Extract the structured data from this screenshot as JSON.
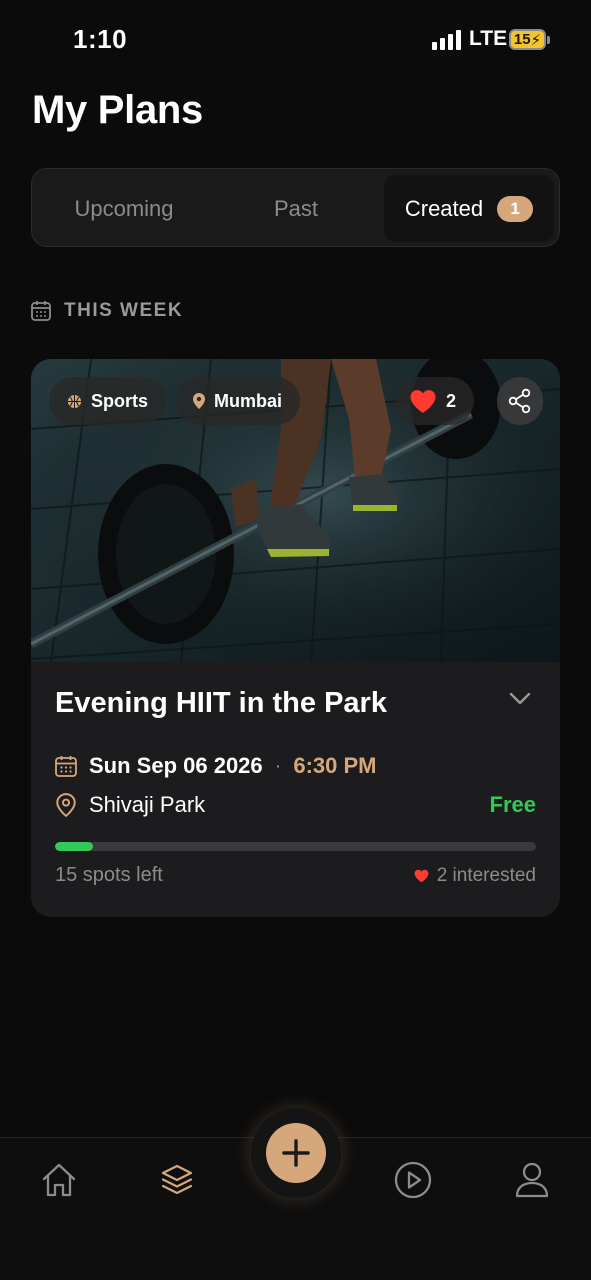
{
  "status_bar": {
    "time": "1:10",
    "network": "LTE",
    "battery": "15"
  },
  "page": {
    "title": "My Plans"
  },
  "tabs": [
    {
      "label": "Upcoming",
      "active": false
    },
    {
      "label": "Past",
      "active": false
    },
    {
      "label": "Created",
      "active": true,
      "badge": "1"
    }
  ],
  "section": {
    "title": "THIS WEEK",
    "icon": "calendar-icon"
  },
  "plan_card": {
    "category": "Sports",
    "location_tag": "Mumbai",
    "likes": "2",
    "title": "Evening HIIT in the Park",
    "date": "Sun Sep 06 2026",
    "separator": "·",
    "time": "6:30 PM",
    "venue": "Shivaji Park",
    "price": "Free",
    "spots_left": "15 spots left",
    "interested": "2 interested",
    "progress_fraction": 0.08
  },
  "bottom_nav": {
    "items": [
      "home-icon",
      "layers-icon",
      "add-icon",
      "play-icon",
      "profile-icon"
    ],
    "active": "layers-icon"
  },
  "colors": {
    "accent": "#d6a77a",
    "success": "#34c759",
    "heart": "#ff3b30",
    "background": "#0b0b0b",
    "card": "#1c1c1e"
  }
}
